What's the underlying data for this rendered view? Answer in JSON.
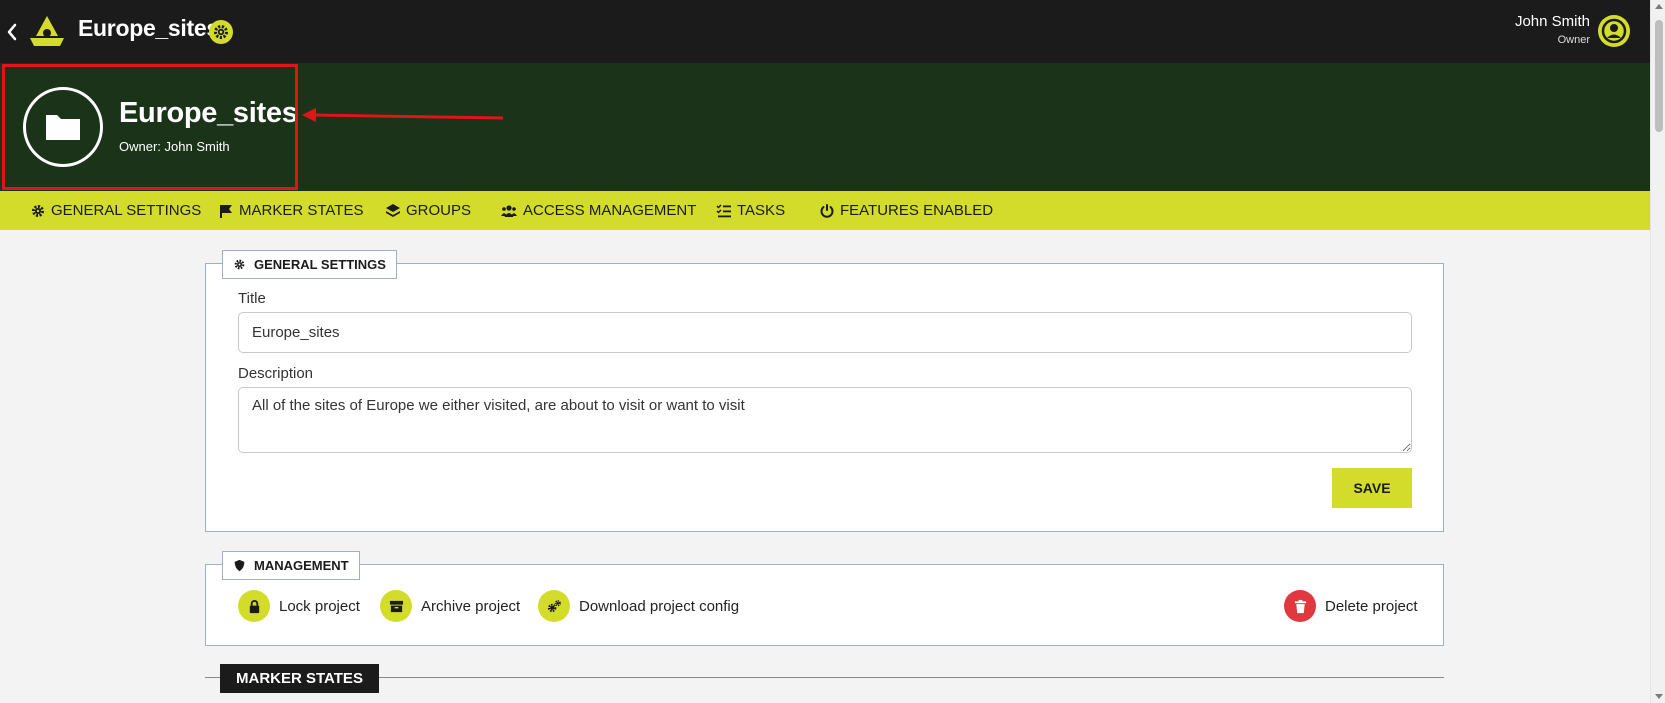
{
  "topbar": {
    "title": "Europe_sites",
    "user_name": "John Smith",
    "user_role": "Owner"
  },
  "header": {
    "project_name": "Europe_sites",
    "owner_line": "Owner: John Smith"
  },
  "tabs": [
    {
      "label": "GENERAL SETTINGS",
      "icon": "gear-icon"
    },
    {
      "label": "MARKER STATES",
      "icon": "flag-icon"
    },
    {
      "label": "GROUPS",
      "icon": "layers-icon"
    },
    {
      "label": "ACCESS MANAGEMENT",
      "icon": "users-icon"
    },
    {
      "label": "TASKS",
      "icon": "checklist-icon"
    },
    {
      "label": "FEATURES ENABLED",
      "icon": "power-icon"
    }
  ],
  "general": {
    "legend": "GENERAL SETTINGS",
    "title_label": "Title",
    "title_value": "Europe_sites",
    "description_label": "Description",
    "description_value": "All of the sites of Europe we either visited, are about to visit or want to visit",
    "save_label": "SAVE"
  },
  "management": {
    "legend": "MANAGEMENT",
    "items": [
      {
        "label": "Lock project",
        "icon": "lock-icon"
      },
      {
        "label": "Archive project",
        "icon": "archive-icon"
      },
      {
        "label": "Download project config",
        "icon": "gears-icon"
      },
      {
        "label": "Delete project",
        "icon": "trash-icon"
      }
    ]
  },
  "marker_states": {
    "heading": "MARKER STATES"
  },
  "colors": {
    "topbar": "#1b1b1b",
    "header_band": "#1b3319",
    "accent": "#d4dc2b",
    "danger": "#e0383e",
    "annotation": "#e1141a"
  }
}
